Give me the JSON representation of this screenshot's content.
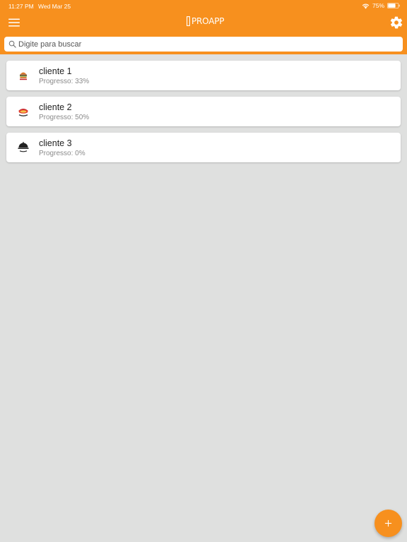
{
  "status_bar": {
    "time": "11:27 PM",
    "date": "Wed Mar 25",
    "battery": "75%",
    "battery_level": 0.75
  },
  "header": {
    "app_title": "PROAPP",
    "accent_color": "#f7901e",
    "menu_icon": "hamburger-menu-icon",
    "settings_icon": "gear-icon"
  },
  "search": {
    "placeholder": "Digite para buscar",
    "value": ""
  },
  "clients": [
    {
      "name": "cliente 1",
      "progress": "Progresso: 33%",
      "avatar_icon": "burger-logo-icon"
    },
    {
      "name": "cliente 2",
      "progress": "Progresso: 50%",
      "avatar_icon": "pizza-logo-icon"
    },
    {
      "name": "cliente 3",
      "progress": "Progresso: 0%",
      "avatar_icon": "restaurant-logo-icon"
    }
  ],
  "fab": {
    "label": "+",
    "icon": "plus-icon"
  }
}
